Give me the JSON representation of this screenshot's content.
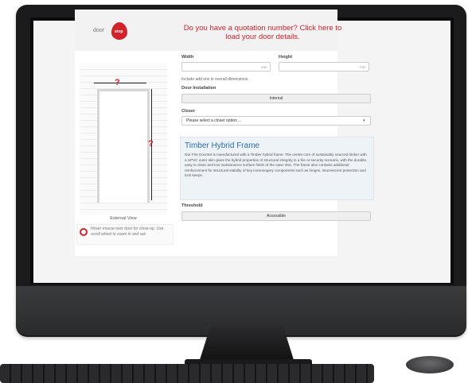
{
  "brand": {
    "logo_text": "door",
    "logo_badge": "stop",
    "accent": "#d2232a"
  },
  "header": {
    "quote_link": "Do you have a quotation number? Click here to load your door details."
  },
  "illustration": {
    "width_marker": "?",
    "height_marker": "?",
    "caption": "External View",
    "hover_hint": "Hover mouse over door for close-up. Use scroll wheel to zoom in and out."
  },
  "form": {
    "width_label": "Width",
    "height_label": "Height",
    "width_unit": "mm",
    "height_unit": "mm",
    "addons_note": "Include add ons in overall dimensions.",
    "installation_label": "Door Installation",
    "installation_value": "Internal",
    "closer_label": "Closer",
    "closer_placeholder": "Please select a closer option ...",
    "threshold_label": "Threshold",
    "threshold_value": "Accessible"
  },
  "info_panel": {
    "title": "Timber Hybrid Frame",
    "body": "Our Fire Doorset is manufactured with a Timber hybrid frame. The centre core of sustainably sourced timber with a UPVC outer skin gives the hybrid properties of structural integrity in a fire or security scenario, with the durable, easy to clean and low maintenance surface finish of the outer skin. The frame also contains additional reinforcement for structural stability of key ironmongery components such as hinges, intumescent protection and lock keeps.",
    "accent": "#2b6cb0"
  }
}
